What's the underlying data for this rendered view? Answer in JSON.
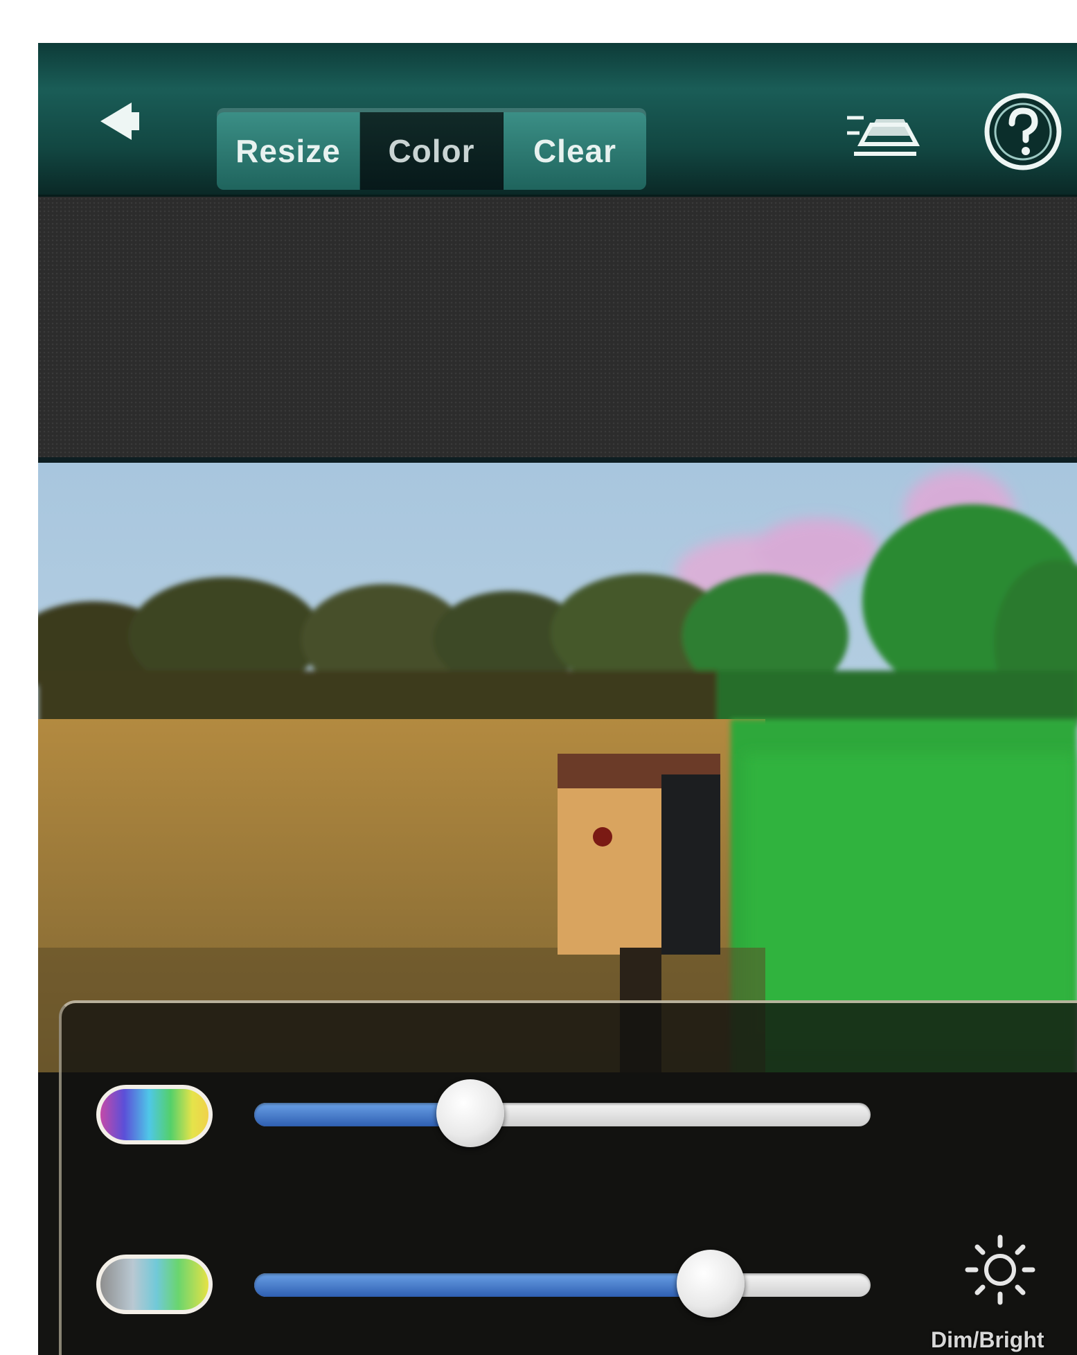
{
  "topbar": {
    "back_icon": "back-arrow-icon",
    "tabs": [
      {
        "label": "Resize",
        "active": false
      },
      {
        "label": "Color",
        "active": true
      },
      {
        "label": "Clear",
        "active": false
      }
    ],
    "tool_icon": "layers-tool-icon",
    "help_icon": "help-icon"
  },
  "photo": {
    "description_icon": "landscape-photo"
  },
  "controls": {
    "hue_slider": {
      "icon": "hue-spectrum-pill",
      "value": 0.35
    },
    "saturation_slider": {
      "icon": "saturation-spectrum-pill",
      "value": 0.74
    },
    "brightness": {
      "icon": "brightness-sun-icon",
      "label": "Dim/Bright"
    }
  },
  "colors": {
    "topbar": "#1a5d57",
    "slider_fill": "#3f73c8",
    "panel_border": "#ebe1c8"
  }
}
